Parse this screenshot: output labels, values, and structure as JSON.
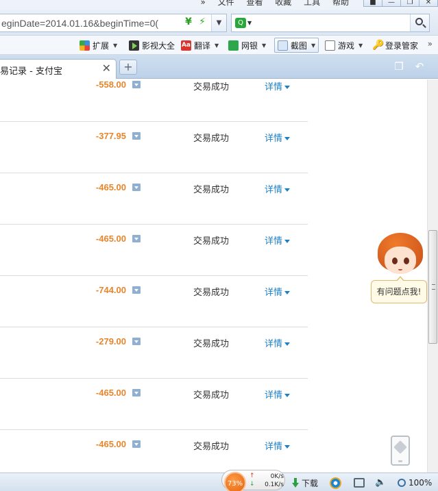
{
  "menubar": {
    "chevron": "»",
    "items": [
      "文件",
      "查看",
      "收藏",
      "工具",
      "帮助"
    ]
  },
  "window_controls": [
    "■",
    "—",
    "❐",
    "✕"
  ],
  "address": {
    "url": "eginDate=2014.01.16&beginTime=0(",
    "yen_icon": "¥",
    "bolt_icon": "⚡",
    "dropdown": "▼"
  },
  "search": {
    "placeholder": "",
    "engine_icon": "Q"
  },
  "toolbar": {
    "extensions": "扩展",
    "videos": "影视大全",
    "translate": "翻译",
    "translate_icon": "Aa",
    "netbank": "网银",
    "screenshot": "截图",
    "games": "游戏",
    "login_manager": "登录管家",
    "more": "»",
    "dropdown": "▼"
  },
  "tab": {
    "title": "易记录 - 支付宝",
    "close": "✕",
    "new_tab": "+"
  },
  "transactions": [
    {
      "amount": "-558.00",
      "status": "交易成功",
      "detail": "详情"
    },
    {
      "amount": "-377.95",
      "status": "交易成功",
      "detail": "详情"
    },
    {
      "amount": "-465.00",
      "status": "交易成功",
      "detail": "详情"
    },
    {
      "amount": "-465.00",
      "status": "交易成功",
      "detail": "详情"
    },
    {
      "amount": "-744.00",
      "status": "交易成功",
      "detail": "详情"
    },
    {
      "amount": "-279.00",
      "status": "交易成功",
      "detail": "详情"
    },
    {
      "amount": "-465.00",
      "status": "交易成功",
      "detail": "详情"
    },
    {
      "amount": "-465.00",
      "status": "交易成功",
      "detail": "详情"
    }
  ],
  "help": {
    "label": "有问题点我!"
  },
  "statusbar": {
    "cpu_percent": "73%",
    "upload_speed": "0K/s",
    "download_speed": "0.1K/s",
    "up_arrow": "↑",
    "down_arrow": "↓",
    "download": "下载",
    "zoom": "100%"
  },
  "colors": {
    "amount": "#e8852a",
    "detail_link": "#1d7fc6"
  }
}
